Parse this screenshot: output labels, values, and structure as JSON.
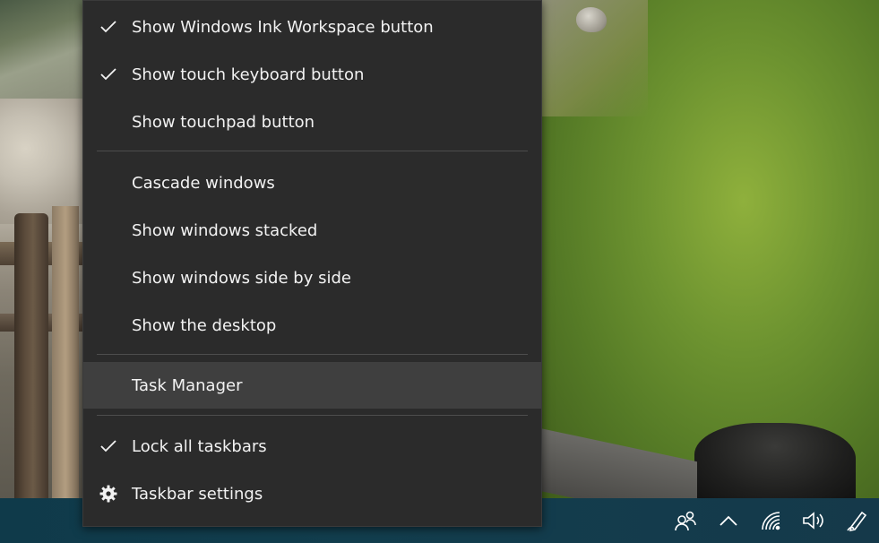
{
  "context_menu": {
    "items": [
      {
        "label": "Show Windows Ink Workspace button",
        "checked": true
      },
      {
        "label": "Show touch keyboard button",
        "checked": true
      },
      {
        "label": "Show touchpad button",
        "checked": false
      },
      {
        "label": "Cascade windows",
        "checked": false
      },
      {
        "label": "Show windows stacked",
        "checked": false
      },
      {
        "label": "Show windows side by side",
        "checked": false
      },
      {
        "label": "Show the desktop",
        "checked": false
      },
      {
        "label": "Task Manager",
        "checked": false,
        "highlighted": true
      },
      {
        "label": "Lock all taskbars",
        "checked": true
      },
      {
        "label": "Taskbar settings",
        "icon": "gear-icon"
      }
    ]
  },
  "tray": {
    "icons": [
      "people-icon",
      "chevron-up-icon",
      "wifi-icon",
      "volume-icon",
      "pen-icon"
    ]
  },
  "colors": {
    "menu_bg": "#2b2b2b",
    "menu_highlight": "#3f3f3f",
    "menu_text": "#f2f2f2",
    "separator": "#4d4d4d",
    "taskbar_bg": "#123e4e"
  }
}
